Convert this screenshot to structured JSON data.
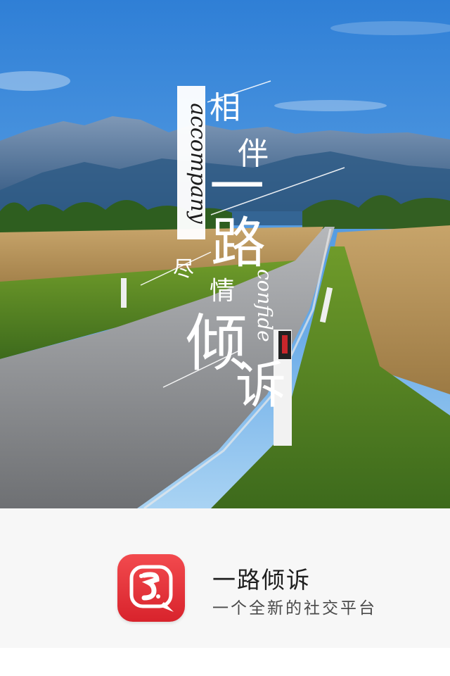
{
  "hero": {
    "title_chars": [
      "相",
      "伴",
      "一",
      "路",
      "尽",
      "情",
      "倾",
      "诉"
    ],
    "english_vertical_1": "accompany",
    "english_vertical_2": "confide"
  },
  "app": {
    "icon_name": "app-logo-icon",
    "name": "一路倾诉",
    "tagline": "一个全新的社交平台",
    "icon_color": "#e6333a"
  }
}
